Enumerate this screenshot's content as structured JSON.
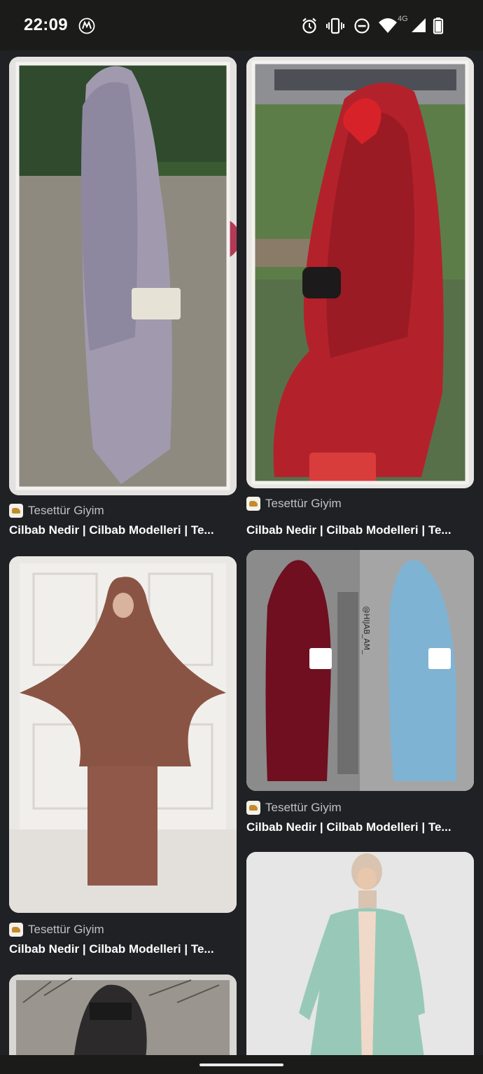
{
  "status_bar": {
    "time": "22:09",
    "network": "4G",
    "icons": [
      "motorola-icon",
      "alarm-icon",
      "vibrate-icon",
      "do-not-disturb-icon",
      "wifi-icon",
      "signal-icon",
      "battery-icon"
    ]
  },
  "results": [
    {
      "source": "Tesettür Giyim",
      "title": "Cilbab Nedir | Cilbab Modelleri | Te...",
      "image": "lavender jilbab outfit"
    },
    {
      "source": "Tesettür Giyim",
      "title": "Cilbab Nedir | Cilbab Modelleri | Te...",
      "image": "red jilbab outfit"
    },
    {
      "source": "Tesettür Giyim",
      "title": "Cilbab Nedir | Cilbab Modelleri | Te...",
      "image": "brown jilbab outfit"
    },
    {
      "source": "Tesettür Giyim",
      "title": "Cilbab Nedir | Cilbab Modelleri | Te...",
      "image": "maroon and blue jilbab outfits",
      "watermark": "@HIJAB_AM_"
    },
    {
      "image": "mint green kimono outfit"
    },
    {
      "image": "black niqab outfit"
    }
  ],
  "colors": {
    "background": "#202124",
    "status_bar": "#1b1b19",
    "title_text": "#ffffff",
    "source_text": "#bdc1c6"
  }
}
